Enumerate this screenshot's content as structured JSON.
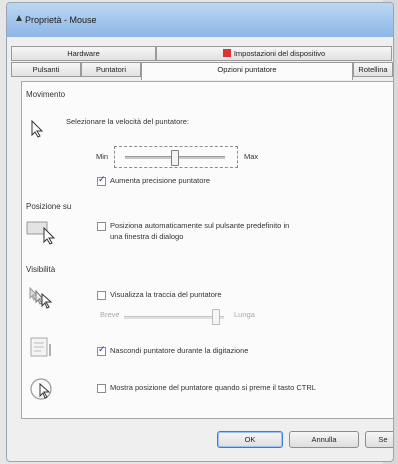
{
  "window": {
    "title": "Proprietà - Mouse"
  },
  "tabs": {
    "row1": [
      "Hardware",
      "Impostazioni del dispositivo"
    ],
    "row2": [
      "Pulsanti",
      "Puntatori",
      "Opzioni puntatore",
      "Rotellina"
    ]
  },
  "sections": {
    "movimento": {
      "label": "Movimento",
      "speed_label": "Selezionare la velocità del puntatore:",
      "min": "Min",
      "max": "Max",
      "precision_label": "Aumenta precisione puntatore",
      "precision_checked": true
    },
    "posizione": {
      "label": "Posizione su",
      "snap_label_line1": "Posiziona automaticamente sul pulsante predefinito in",
      "snap_label_line2": "una finestra di dialogo",
      "snap_checked": false
    },
    "visibilita": {
      "label": "Visibilità",
      "trails_label": "Visualizza la traccia del puntatore",
      "trails_checked": false,
      "trails_short": "Breve",
      "trails_long": "Lunga",
      "hide_label": "Nascondi puntatore durante la digitazione",
      "hide_checked": true,
      "ctrl_label": "Mostra posizione del puntatore quando si preme il tasto CTRL",
      "ctrl_checked": false
    }
  },
  "buttons": {
    "ok": "OK",
    "cancel": "Annulla",
    "apply": "Se"
  }
}
